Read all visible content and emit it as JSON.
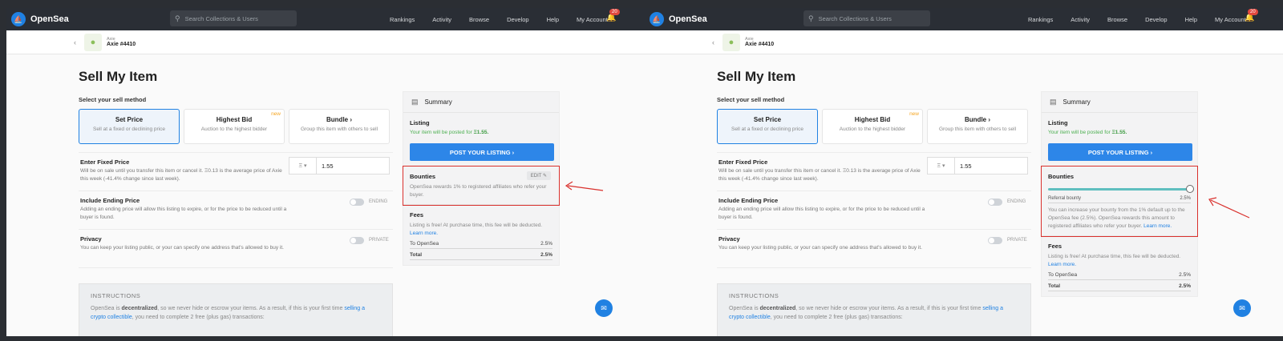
{
  "header": {
    "brand": "OpenSea",
    "search_placeholder": "Search Collections & Users",
    "nav": [
      "Rankings",
      "Activity",
      "Browse",
      "Develop",
      "Help",
      "My Account"
    ],
    "notif_count": "20"
  },
  "item": {
    "collection": "Axie",
    "name": "Axie #4410",
    "back": "‹"
  },
  "page": {
    "title": "Sell My Item",
    "method_label": "Select your sell method",
    "methods": [
      {
        "title": "Set Price",
        "sub": "Sell at a fixed or declining price"
      },
      {
        "title": "Highest Bid",
        "sub": "Auction to the highest bidder",
        "tag": "new"
      },
      {
        "title": "Bundle ›",
        "sub": "Group this item with others to sell"
      }
    ],
    "fixed_price": {
      "title": "Enter Fixed Price",
      "desc": "Will be on sale until you transfer this item or cancel it. Ξ0.13 is the average price of Axie this week (-41.4% change since last week).",
      "value": "1.55",
      "currency": "Ξ ▾"
    },
    "ending": {
      "title": "Include Ending Price",
      "desc": "Adding an ending price will allow this listing to expire, or for the price to be reduced until a buyer is found.",
      "toggle": "ENDING"
    },
    "privacy": {
      "title": "Privacy",
      "desc": "You can keep your listing public, or your can specify one address that's allowed to buy it.",
      "toggle": "PRIVATE"
    },
    "instructions": {
      "title": "INSTRUCTIONS",
      "text_a": "OpenSea is ",
      "text_b": "decentralized",
      "text_c": ", so we never hide or escrow your items. As a result, if this is your first time ",
      "link": "selling a crypto collectible",
      "text_d": ", you need to complete 2 free (plus gas) transactions:"
    }
  },
  "summary": {
    "title": "Summary",
    "listing_label": "Listing",
    "listing_text": "Your item will be posted for ",
    "listing_price": "Ξ1.55.",
    "post_button": "POST YOUR LISTING ›",
    "bounties_label": "Bounties",
    "edit": "EDIT ✎",
    "bounties_text_left": "OpenSea rewards 1% to registered affiliates who refer your buyer.",
    "referral_label": "Referral bounty",
    "referral_value": "2.5%",
    "bounties_text_right": "You can increase your bounty from the 1% default up to the OpenSea fee (2.5%). OpenSea rewards this amount to registered affiliates who refer your buyer.",
    "learn_more": "Learn more.",
    "fees_label": "Fees",
    "fees_text": "Listing is free! At purchase time, this fee will be deducted. ",
    "fee_rows": [
      {
        "label": "To OpenSea",
        "value": "2.5%"
      },
      {
        "label": "Total",
        "value": "2.5%"
      }
    ]
  },
  "colors": {
    "accent": "#2081e2",
    "highlight": "#d9302c",
    "slider": "#5fbfbf"
  }
}
